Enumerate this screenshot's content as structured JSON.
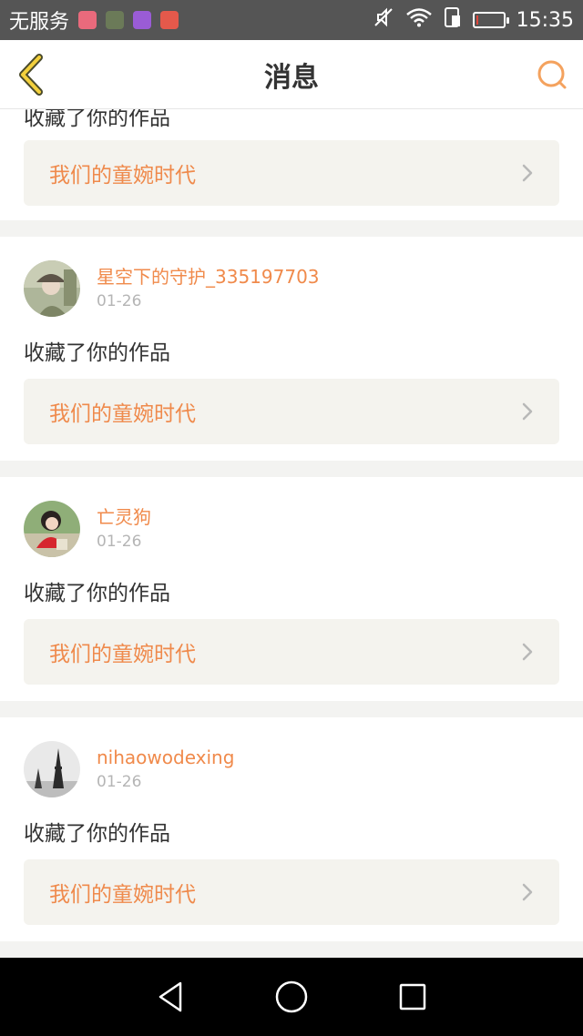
{
  "status_bar": {
    "carrier": "无服务",
    "time": "15:35",
    "battery_level": 0.08,
    "app_badges": [
      "#e96a7c",
      "#6b7a58",
      "#9a5cd6",
      "#e4594b"
    ]
  },
  "header": {
    "title": "消息"
  },
  "colors": {
    "accent": "#f08a4b",
    "chevron": "#b8b8b8"
  },
  "notifications": [
    {
      "action": "收藏了你的作品",
      "work_title": "我们的童婉时代",
      "partial": true
    },
    {
      "username": "星空下的守护_335197703",
      "date": "01-26",
      "action": "收藏了你的作品",
      "work_title": "我们的童婉时代",
      "avatar": "avatar-photo-girl-hat"
    },
    {
      "username": "亡灵狗",
      "date": "01-26",
      "action": "收藏了你的作品",
      "work_title": "我们的童婉时代",
      "avatar": "avatar-photo-child-red"
    },
    {
      "username": "nihaowodexing",
      "date": "01-26",
      "action": "收藏了你的作品",
      "work_title": "我们的童婉时代",
      "avatar": "avatar-photo-eiffel-tower"
    }
  ],
  "nav_bar": {
    "buttons": [
      "back-triangle-icon",
      "home-circle-icon",
      "recents-square-icon"
    ]
  }
}
